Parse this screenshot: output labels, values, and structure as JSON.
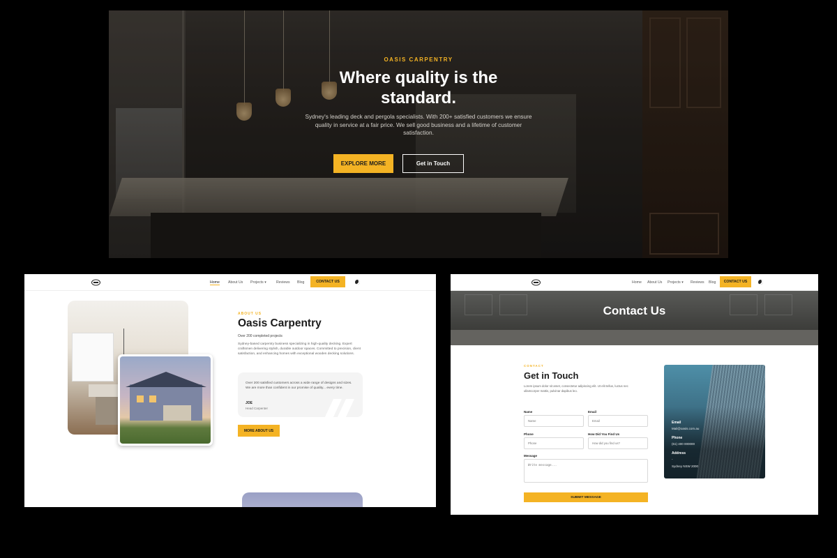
{
  "hero": {
    "eyebrow": "OASIS CARPENTRY",
    "title_line1": "Where quality is the",
    "title_line2": "standard.",
    "description": "Sydney's leading deck and pergola specialists. With 200+ satisfied customers we ensure quality in service at a fair price. We sell good business and a lifetime of customer satisfaction.",
    "primary_button": "EXPLORE MORE",
    "secondary_button": "Get in Touch"
  },
  "about_page": {
    "nav": {
      "items": [
        "Home",
        "About Us",
        "Projects",
        "Reviews",
        "Blog"
      ],
      "projects_caret": "▾",
      "cta": "CONTACT US"
    },
    "eyebrow": "ABOUT US",
    "title": "Oasis Carpentry",
    "subtitle": "Over 200 completed projects",
    "description": "Sydney-based carpentry business specializing in high-quality decking. Expert craftsmen delivering stylish, durable outdoor spaces. Committed to precision, client satisfaction, and enhancing homes with exceptional wooden decking solutions.",
    "testimonial": {
      "quote": "Over 200 satisfied customers across a wide range of designs and sizes. We are more than confident in our promise of quality... every time.",
      "name": "JOE",
      "role": "Head Carpenter"
    },
    "button": "MORE ABOUT US"
  },
  "contact_page": {
    "nav": {
      "items": [
        "Home",
        "About Us",
        "Projects",
        "Reviews",
        "Blog"
      ],
      "projects_caret": "▾",
      "cta": "CONTACT US"
    },
    "banner_title": "Contact Us",
    "eyebrow": "CONTACT",
    "title": "Get in Touch",
    "description": "Lorem ipsum dolor sit amet, consectetur adipiscing elit. Ut elit tellus, luctus nec ullamcorper mattis, pulvinar dapibus leo.",
    "form": {
      "name_label": "Name",
      "name_placeholder": "Name",
      "email_label": "Email",
      "email_placeholder": "Email",
      "phone_label": "Phone",
      "phone_placeholder": "Phone",
      "source_label": "How Did You Find Us",
      "source_placeholder": "How did you find us?",
      "message_label": "Message",
      "message_placeholder": "Write message...",
      "submit": "SUBMIT MESSAGE"
    },
    "info": {
      "email_label": "Email",
      "email_value": "Mail@oasis.com.au",
      "phone_label": "Phone",
      "phone_value": "(61) 400 000000",
      "address_label": "Address",
      "address_line1": "-",
      "address_line2": "Sydney NSW 2000"
    }
  },
  "colors": {
    "accent": "#f4b324",
    "dark": "#1b1b1b",
    "background": "#000000"
  },
  "icons": [
    "logo-icon",
    "moon-icon",
    "chevron-down-icon"
  ]
}
